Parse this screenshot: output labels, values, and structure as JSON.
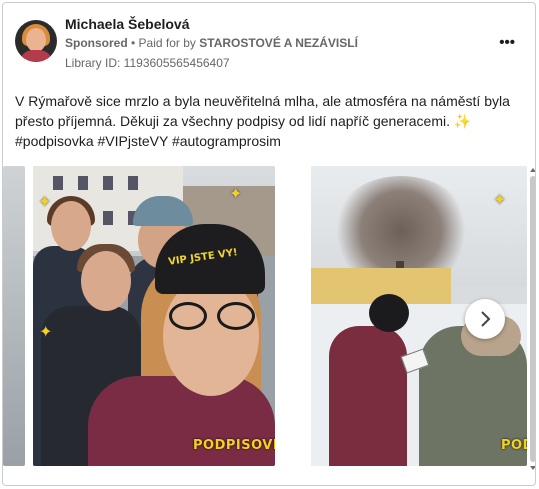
{
  "post": {
    "author": "Michaela Šebelová",
    "sponsored_label": "Sponsored",
    "paid_prefix": " • Paid for by ",
    "payer": "STAROSTOVÉ A NEZÁVISLÍ",
    "library_id": "Library ID: 1193605565456407",
    "more_icon": "•••",
    "text_line1": "V Rýmařově sice mrzlo a byla neuvěřitelná mlha, ale atmosféra na náměstí byla",
    "text_line2": "přesto příjemná. Děkuji za všechny podpisy od lidí napříč generacemi.",
    "sparkle": "✨",
    "hashtags": "#podpisovka #VIPjsteVY #autogramprosim"
  },
  "carousel": {
    "card1_overlay": "PODPISOVKA",
    "card1_hat_text": "VIP JSTE VY!",
    "card2_overlay": "PODPI",
    "next_icon": "chevron-right-icon"
  },
  "colors": {
    "accent_yellow": "#f3d21f",
    "text": "#1c1e21",
    "muted": "#65676b"
  }
}
